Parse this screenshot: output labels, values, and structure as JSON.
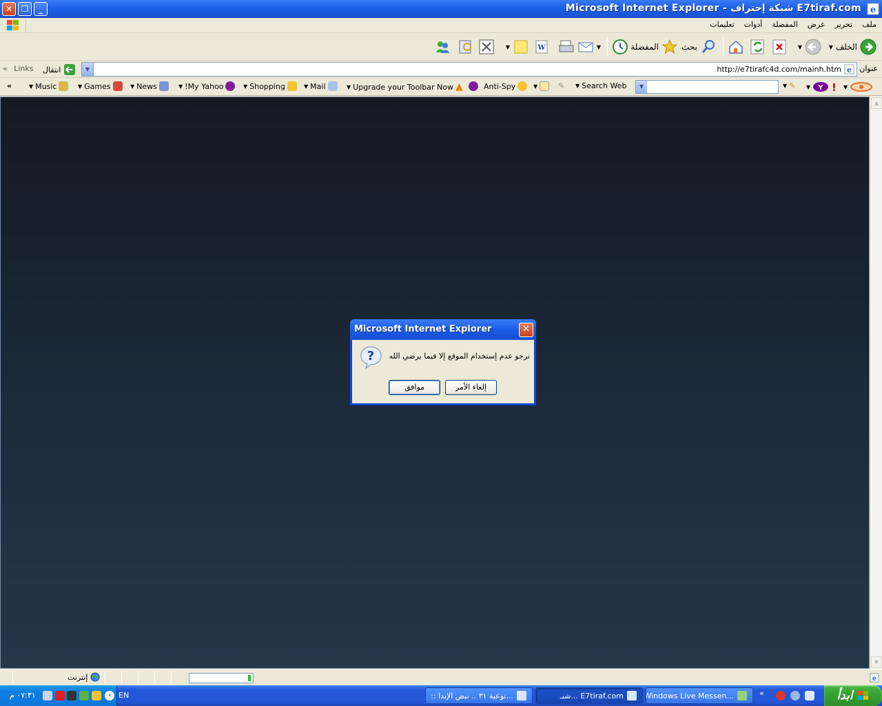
{
  "window": {
    "title": "Microsoft Internet Explorer - شبكة إحتراف E7tiraf.com",
    "minimize": "_",
    "restore": "❐",
    "close": "✕"
  },
  "menu": [
    "ملف",
    "تحرير",
    "عرض",
    "المفضلة",
    "أدوات",
    "تعليمات"
  ],
  "toolbar": {
    "back_label": "الخلف",
    "search_label": "بحث",
    "favorites_label": "المفضلة"
  },
  "address": {
    "label": "عنوان",
    "url": "http://e7tirafc4d.com/mainh.htm",
    "go_label": "انتقال",
    "links_label": "Links",
    "chevron": "«"
  },
  "yahoo_toolbar": {
    "chevron": "«",
    "items": [
      "Music",
      "Games",
      "News",
      "!My Yahoo",
      "Shopping",
      "Mail",
      "Upgrade your Toolbar Now",
      "Anti-Spy"
    ],
    "search_web": "Search Web",
    "search_value": ""
  },
  "dialog": {
    "title": "Microsoft Internet Explorer",
    "message": "نرجو عدم إستخدام الموقع إلا فيما يرضي الله",
    "ok_label": "موافق",
    "cancel_label": "إلغاء الأمر"
  },
  "status": {
    "zone": "إنترنت",
    "progress": 0.04
  },
  "taskbar": {
    "clock": "٠٧:٣١ م",
    "language": "EN",
    "tasks": [
      ":: توعية ٣١ .. نبض الإبدا...",
      "شبـ... E7tiraf.com",
      "Windows Live Messen..."
    ],
    "start_label": "ابدأ",
    "chevron": "«"
  },
  "colors": {
    "titlebar": "#1f5ee8",
    "content_top": "#131a24",
    "content_bottom": "#24384b",
    "start": "#37a332"
  }
}
